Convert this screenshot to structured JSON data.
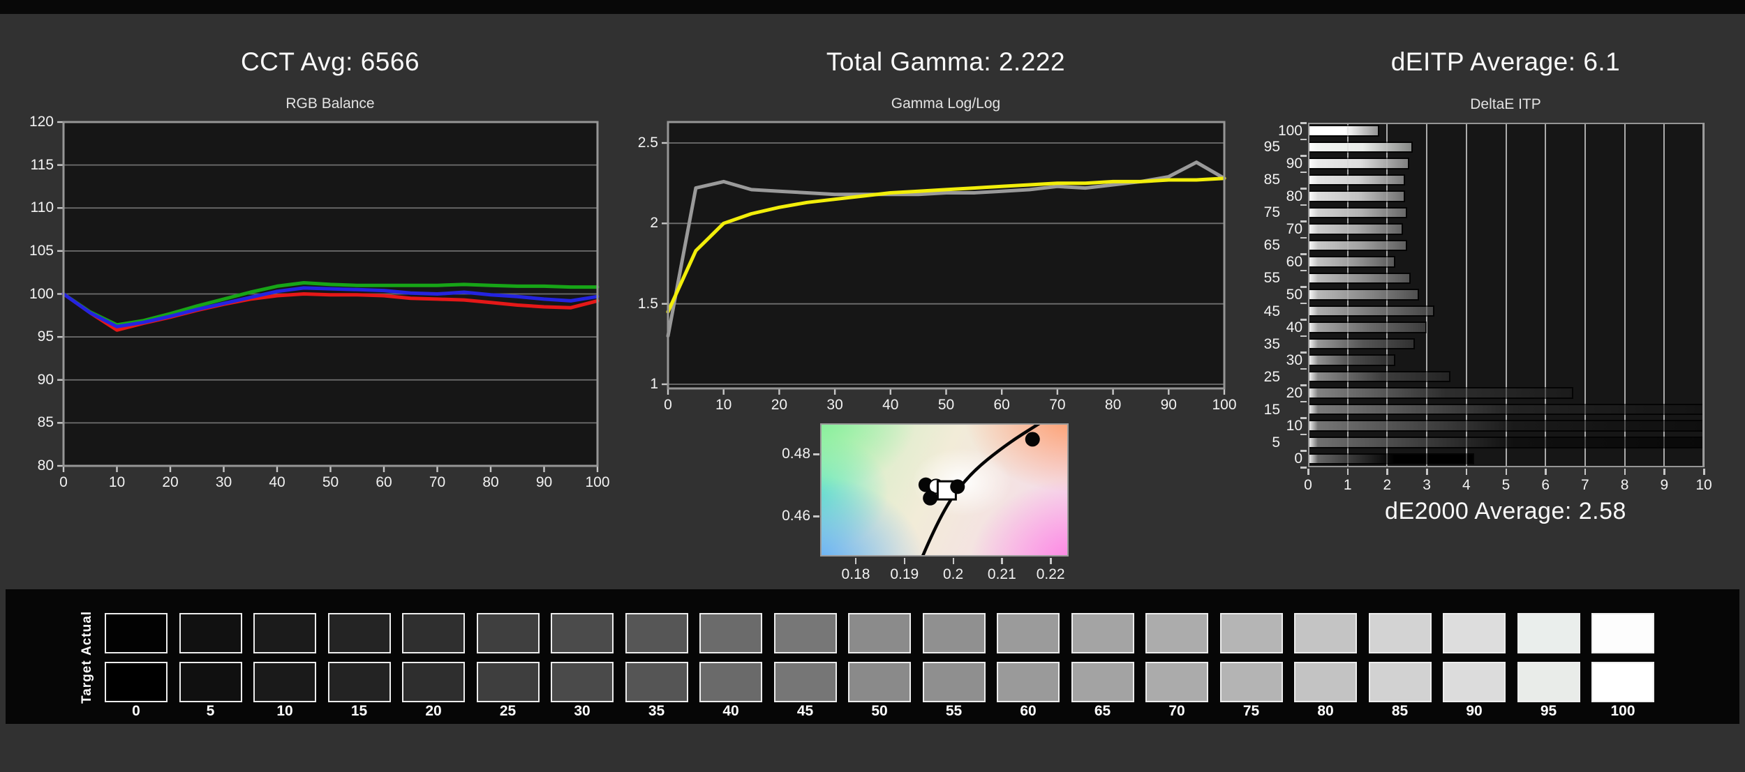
{
  "page": {
    "background": "#313131",
    "top_bar_color": "#080808",
    "plot_background": "#161616",
    "gridline_color": "#6f6f6f",
    "border_color": "#969696"
  },
  "chart_data": [
    {
      "id": "rgb_balance",
      "type": "line",
      "title": "CCT Avg: 6566",
      "subtitle": "RGB Balance",
      "xlabel": "",
      "ylabel": "",
      "xlim": [
        0,
        100
      ],
      "ylim": [
        80,
        120
      ],
      "xticks": [
        0,
        10,
        20,
        30,
        40,
        50,
        60,
        70,
        80,
        90,
        100
      ],
      "yticks": [
        80,
        85,
        90,
        95,
        100,
        105,
        110,
        115,
        120
      ],
      "grid": "horizontal",
      "x": [
        0,
        5,
        10,
        15,
        20,
        25,
        30,
        35,
        40,
        45,
        50,
        55,
        60,
        65,
        70,
        75,
        80,
        85,
        90,
        95,
        100
      ],
      "series": [
        {
          "name": "green",
          "color": "#17a517",
          "values": [
            100,
            97.9,
            96.4,
            96.9,
            97.7,
            98.6,
            99.4,
            100.2,
            100.9,
            101.3,
            101.1,
            101.0,
            101.0,
            101.0,
            101.0,
            101.1,
            101.0,
            100.9,
            100.9,
            100.8,
            100.8
          ]
        },
        {
          "name": "red",
          "color": "#e51818",
          "values": [
            100,
            97.8,
            95.8,
            96.6,
            97.3,
            98.1,
            98.8,
            99.4,
            99.8,
            100.0,
            99.9,
            99.9,
            99.8,
            99.5,
            99.4,
            99.3,
            99.0,
            98.7,
            98.5,
            98.4,
            99.2
          ]
        },
        {
          "name": "blue",
          "color": "#2424e0",
          "values": [
            100,
            97.8,
            96.2,
            96.7,
            97.4,
            98.2,
            98.9,
            99.6,
            100.3,
            100.7,
            100.6,
            100.5,
            100.4,
            100.1,
            100.0,
            100.2,
            99.9,
            99.7,
            99.4,
            99.2,
            99.7
          ]
        }
      ]
    },
    {
      "id": "gamma",
      "type": "line",
      "title": "Total Gamma: 2.222",
      "subtitle": "Gamma Log/Log",
      "xlabel": "",
      "ylabel": "",
      "xlim": [
        0,
        100
      ],
      "ylim": [
        0.974,
        2.63
      ],
      "xticks": [
        0,
        10,
        20,
        30,
        40,
        50,
        60,
        70,
        80,
        90,
        100
      ],
      "yticks": [
        1,
        1.5,
        2,
        2.5
      ],
      "grid": "horizontal",
      "x": [
        0,
        5,
        10,
        15,
        20,
        25,
        30,
        35,
        40,
        45,
        50,
        55,
        60,
        65,
        70,
        75,
        80,
        85,
        90,
        95,
        100
      ],
      "series": [
        {
          "name": "measured",
          "color": "#9a9a9a",
          "values": [
            1.3,
            2.22,
            2.26,
            2.21,
            2.2,
            2.19,
            2.18,
            2.18,
            2.18,
            2.18,
            2.19,
            2.19,
            2.2,
            2.21,
            2.23,
            2.22,
            2.24,
            2.26,
            2.29,
            2.38,
            2.28
          ]
        },
        {
          "name": "target",
          "color": "#f2ee0a",
          "values": [
            1.45,
            1.83,
            2.0,
            2.06,
            2.1,
            2.13,
            2.15,
            2.17,
            2.19,
            2.2,
            2.21,
            2.22,
            2.23,
            2.24,
            2.25,
            2.25,
            2.26,
            2.26,
            2.27,
            2.27,
            2.28
          ]
        }
      ]
    },
    {
      "id": "cie_whitepoint",
      "type": "scatter",
      "title": "",
      "subtitle": "",
      "xlim": [
        0.1727,
        0.2237
      ],
      "ylim": [
        0.447,
        0.49
      ],
      "xticks": [
        0.18,
        0.19,
        0.2,
        0.21,
        0.22
      ],
      "yticks": [
        0.46,
        0.48
      ],
      "locus_curve": [
        [
          0.1933,
          0.447
        ],
        [
          0.1972,
          0.4615
        ],
        [
          0.203,
          0.474
        ],
        [
          0.2105,
          0.4835
        ],
        [
          0.2175,
          0.4905
        ]
      ],
      "points": [
        {
          "shape": "dot",
          "x": 0.1941,
          "y": 0.4706
        },
        {
          "shape": "circle",
          "x": 0.1962,
          "y": 0.4701
        },
        {
          "shape": "dot",
          "x": 0.195,
          "y": 0.4663
        },
        {
          "shape": "square",
          "x": 0.1984,
          "y": 0.4688
        },
        {
          "shape": "dot",
          "x": 0.2006,
          "y": 0.47
        },
        {
          "shape": "dot",
          "x": 0.216,
          "y": 0.4853
        }
      ]
    },
    {
      "id": "deitp",
      "type": "bar",
      "title": "dEITP Average: 6.1",
      "subtitle": "DeltaE ITP",
      "footer": "dE2000 Average: 2.58",
      "xlim": [
        0,
        10
      ],
      "xticks": [
        0,
        1,
        2,
        3,
        4,
        5,
        6,
        7,
        8,
        9,
        10
      ],
      "categories": [
        100,
        95,
        90,
        85,
        80,
        75,
        70,
        65,
        60,
        55,
        50,
        45,
        40,
        35,
        30,
        25,
        20,
        15,
        10,
        5,
        0
      ],
      "values": [
        1.8,
        2.65,
        2.55,
        2.45,
        2.45,
        2.5,
        2.4,
        2.5,
        2.2,
        2.6,
        2.8,
        3.2,
        3.0,
        2.7,
        2.2,
        3.6,
        6.7,
        10,
        10,
        10,
        4.2
      ]
    }
  ],
  "strip": {
    "row_labels": [
      "Actual",
      "Target"
    ],
    "levels": [
      0,
      5,
      10,
      15,
      20,
      25,
      30,
      35,
      40,
      45,
      50,
      55,
      60,
      65,
      70,
      75,
      80,
      85,
      90,
      95,
      100
    ],
    "actual_colors": [
      "#020202",
      "#111111",
      "#1b1b1b",
      "#242424",
      "#2f2f2f",
      "#3f3f3f",
      "#4b4b4b",
      "#565656",
      "#6b6b6b",
      "#777777",
      "#8b8b8b",
      "#909090",
      "#9b9b9b",
      "#a4a4a4",
      "#acacac",
      "#b5b5b5",
      "#c4c4c4",
      "#d3d3d3",
      "#dddddd",
      "#eaeeec",
      "#fdfdfd"
    ],
    "target_colors": [
      "#000000",
      "#101010",
      "#1a1a1a",
      "#232323",
      "#2e2e2e",
      "#3e3e3e",
      "#4a4a4a",
      "#555555",
      "#6a6a6a",
      "#767676",
      "#8a8a8a",
      "#8f8f8f",
      "#9a9a9a",
      "#a3a3a3",
      "#ababab",
      "#b4b4b4",
      "#c3c3c3",
      "#d2d2d2",
      "#dcdcdc",
      "#e9ece9",
      "#ffffff"
    ],
    "panel_color": "#060606"
  }
}
